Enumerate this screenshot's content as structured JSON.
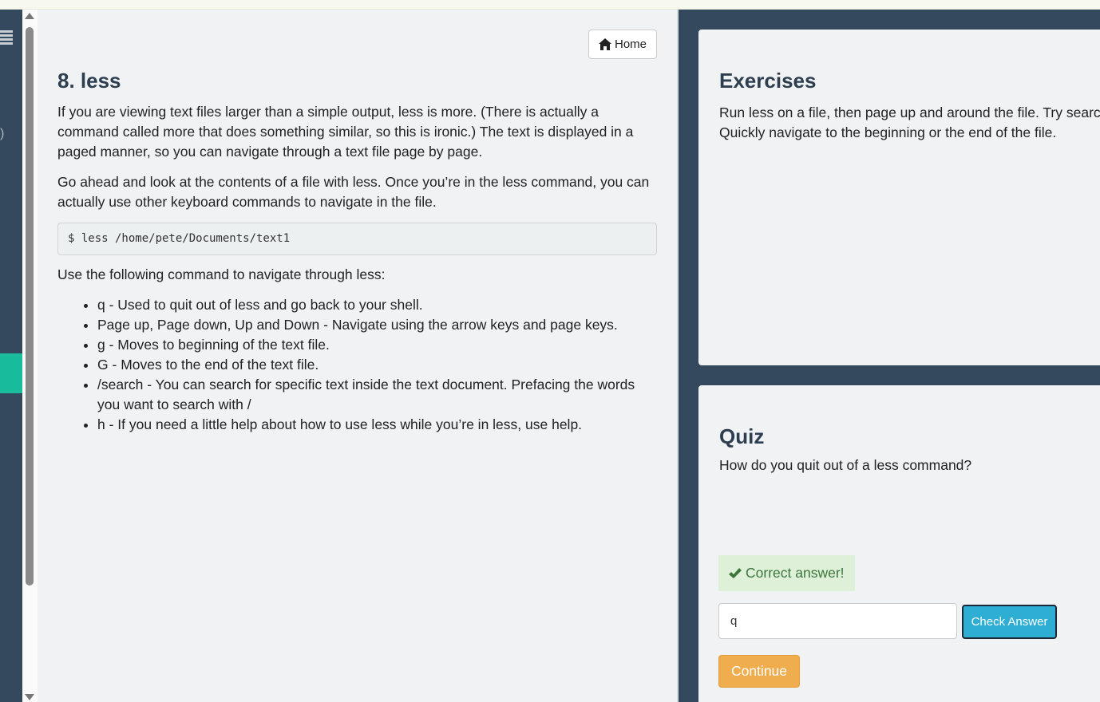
{
  "nav": {
    "fragment_text": ")"
  },
  "header": {
    "home_label": "Home"
  },
  "lesson": {
    "title": "8. less",
    "paragraph1": "If you are viewing text files larger than a simple output, less is more. (There is actually a command called more that does something similar, so this is ironic.) The text is displayed in a paged manner, so you can navigate through a text file page by page.",
    "paragraph2": "Go ahead and look at the contents of a file with less. Once you’re in the less command, you can actually use other keyboard commands to navigate in the file.",
    "code": "$ less /home/pete/Documents/text1",
    "paragraph3": "Use the following command to navigate through less:",
    "list": [
      {
        "key": "q",
        "sep": " - ",
        "desc": "Used to quit out of less and go back to your shell."
      },
      {
        "key": "Page up, Page down, Up and Down",
        "sep": " - ",
        "desc": "Navigate using the arrow keys and page keys."
      },
      {
        "key": "g",
        "sep": " - ",
        "desc": "Moves to beginning of the text file."
      },
      {
        "key": "G",
        "sep": " - ",
        "desc": "Moves to the end of the text file."
      },
      {
        "key": "/search",
        "sep": " - ",
        "desc": "You can search for specific text inside the text document. Prefacing the words you want to search with /"
      },
      {
        "key": "h",
        "sep": " - ",
        "desc": "If you need a little help about how to use less while you’re in less, use help."
      }
    ]
  },
  "exercises": {
    "title": "Exercises",
    "line1": "Run less on a file, then page up and around the file. Try searc",
    "line2": "Quickly navigate to the beginning or the end of the file."
  },
  "quiz": {
    "title": "Quiz",
    "question": "How do you quit out of a less command?",
    "alert_text": "Correct answer!",
    "answer_value": "q",
    "check_label": "Check Answer",
    "continue_label": "Continue"
  },
  "colors": {
    "nav_bg": "#34495e",
    "nav_active": "#18bc9c",
    "heading": "#2c3e50",
    "check_button": "#2eaed3",
    "continue_button": "#f0ad4e",
    "alert_bg": "#dff0d8",
    "alert_text": "#3c763d"
  }
}
